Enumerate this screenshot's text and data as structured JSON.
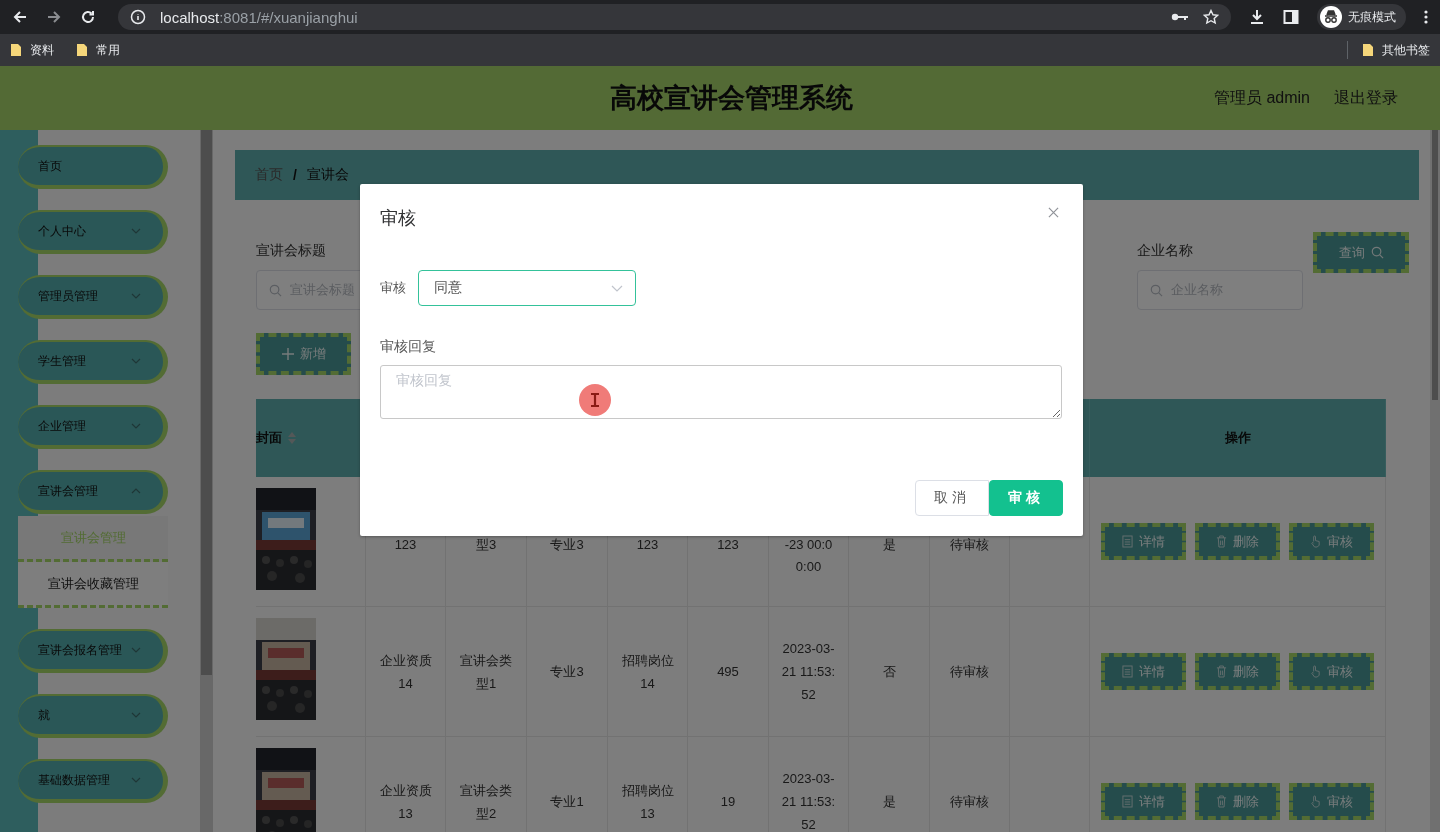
{
  "browser": {
    "url_host": "localhost",
    "url_rest": ":8081/#/xuanjianghui",
    "bookmarks": [
      "资料",
      "常用"
    ],
    "other_bookmarks": "其他书签",
    "profile": "无痕模式"
  },
  "header": {
    "title": "高校宣讲会管理系统",
    "user": "管理员 admin",
    "logout": "退出登录"
  },
  "sidebar": {
    "items": [
      {
        "label": "首页",
        "has_children": false
      },
      {
        "label": "个人中心",
        "has_children": true,
        "expanded": false
      },
      {
        "label": "管理员管理",
        "has_children": true,
        "expanded": false
      },
      {
        "label": "学生管理",
        "has_children": true,
        "expanded": false
      },
      {
        "label": "企业管理",
        "has_children": true,
        "expanded": false
      },
      {
        "label": "宣讲会管理",
        "has_children": true,
        "expanded": true,
        "children": [
          {
            "label": "宣讲会管理",
            "selected": true
          },
          {
            "label": "宣讲会收藏管理",
            "selected": false
          }
        ]
      },
      {
        "label": "宣讲会报名管理",
        "has_children": true,
        "expanded": false
      },
      {
        "label": "就",
        "has_children": true,
        "expanded": false
      },
      {
        "label": "基础数据管理",
        "has_children": true,
        "expanded": false
      }
    ]
  },
  "breadcrumb": {
    "items": [
      "首页",
      "宣讲会"
    ],
    "separator": "/"
  },
  "search": {
    "fields": [
      {
        "label": "宣讲会标题",
        "placeholder": "宣讲会标题"
      },
      {
        "label": "企业名称",
        "placeholder": "企业名称"
      }
    ],
    "button": "查询"
  },
  "add_button": "新增",
  "table": {
    "cover_column": {
      "label": "封面",
      "sortable": true
    },
    "actions_column": "操作",
    "rows": [
      {
        "cells": [
          "123",
          "型3",
          "专业3",
          "123",
          "123",
          "-23 00:00:00",
          "是",
          "待审核"
        ],
        "actions": [
          "详情",
          "删除",
          "审核"
        ]
      },
      {
        "cells": [
          "企业资质14",
          "宣讲会类型1",
          "专业3",
          "招聘岗位14",
          "495",
          "2023-03-21 11:53:52",
          "否",
          "待审核"
        ],
        "actions": [
          "详情",
          "删除",
          "审核"
        ]
      },
      {
        "cells": [
          "企业资质13",
          "宣讲会类型2",
          "专业1",
          "招聘岗位13",
          "19",
          "2023-03-21 11:53:52",
          "是",
          "待审核"
        ],
        "actions": [
          "详情",
          "删除",
          "审核"
        ]
      }
    ]
  },
  "dialog": {
    "title": "审核",
    "review_label": "审核",
    "review_value": "同意",
    "reply_label": "审核回复",
    "reply_placeholder": "审核回复",
    "buttons": [
      {
        "label": "取消",
        "kind": "secondary"
      },
      {
        "label": "审核",
        "kind": "primary"
      }
    ]
  }
}
